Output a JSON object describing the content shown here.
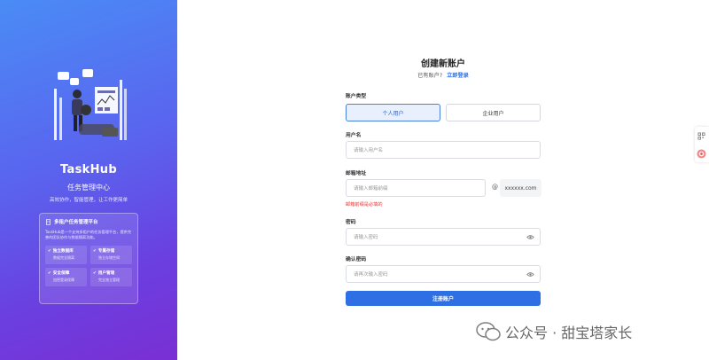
{
  "brand": {
    "name": "TaskHub",
    "subtitle": "任务管理中心",
    "slogan": "高效协作，智能管理，让工作更简单",
    "info_card": {
      "title": "多租户任务管理平台",
      "description": "TaskHub是一个支持多租户的任务管理平台，提供完善的团队协作与数据隔离功能。",
      "features": [
        {
          "title": "独立数据库",
          "desc": "数据完全隔离"
        },
        {
          "title": "专属存储",
          "desc": "独立存储空间"
        },
        {
          "title": "安全保障",
          "desc": "加密登录保障"
        },
        {
          "title": "用户管理",
          "desc": "完全独立管理"
        }
      ]
    }
  },
  "form": {
    "title": "创建新账户",
    "have_account": "已有账户?",
    "login_link": "立即登录",
    "account_type_label": "账户类型",
    "personal_label": "个人用户",
    "enterprise_label": "企业用户",
    "username_label": "用户名",
    "username_placeholder": "请输入用户名",
    "email_label": "邮箱地址",
    "email_placeholder": "请输入邮箱前缀",
    "email_at": "@",
    "email_domain": "xxxxxx.com",
    "email_error": "邮箱前缀是必填的",
    "password_label": "密码",
    "password_placeholder": "请输入密码",
    "confirm_label": "确认密码",
    "confirm_placeholder": "请再次输入密码",
    "submit_label": "注册账户"
  },
  "watermark": {
    "text": "公众号 · 甜宝塔家长"
  },
  "colors": {
    "accent": "#2f6fe4",
    "gradient_start": "#4a8cf6",
    "gradient_end": "#7a2fd3",
    "error": "#e53935"
  }
}
